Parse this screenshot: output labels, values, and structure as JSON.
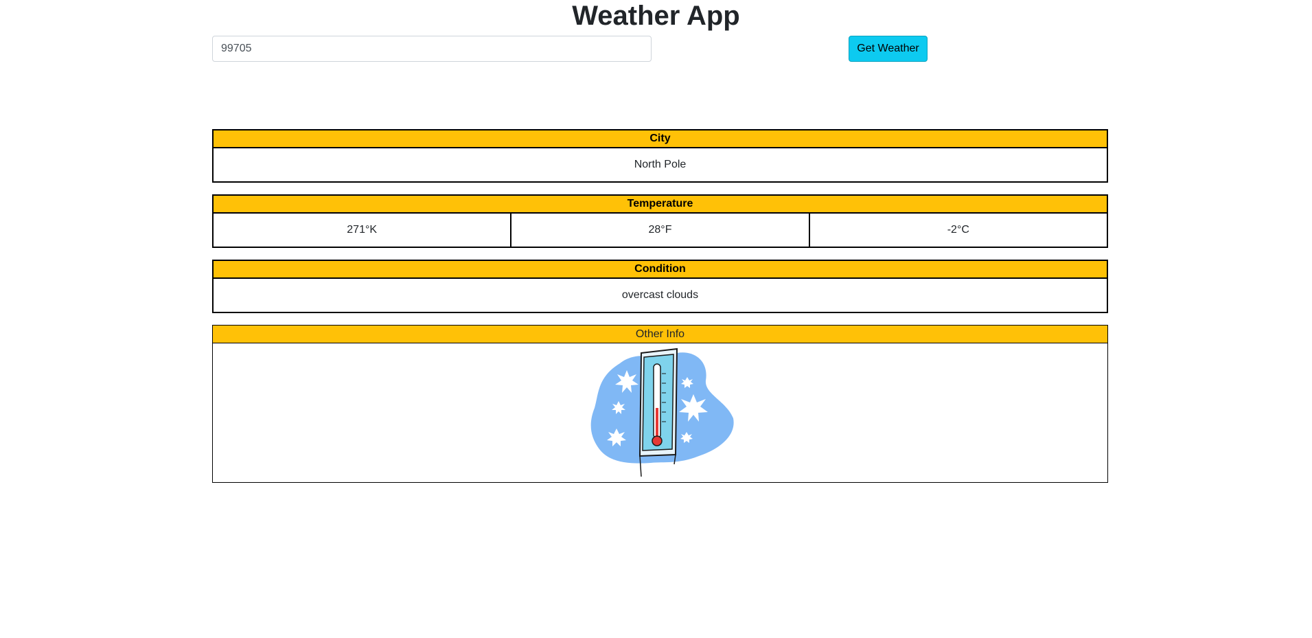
{
  "header": {
    "title": "Weather App"
  },
  "search": {
    "value": "99705",
    "button_label": "Get Weather"
  },
  "city": {
    "label": "City",
    "value": "North Pole"
  },
  "temperature": {
    "label": "Temperature",
    "kelvin": "271°K",
    "fahrenheit": "28°F",
    "celsius": "-2°C"
  },
  "condition": {
    "label": "Condition",
    "value": "overcast clouds"
  },
  "other_info": {
    "label": "Other Info",
    "image": "cold-thermometer-illustration"
  },
  "colors": {
    "header_bar": "#ffc107",
    "button": "#0dcaf0",
    "border": "#000000"
  }
}
